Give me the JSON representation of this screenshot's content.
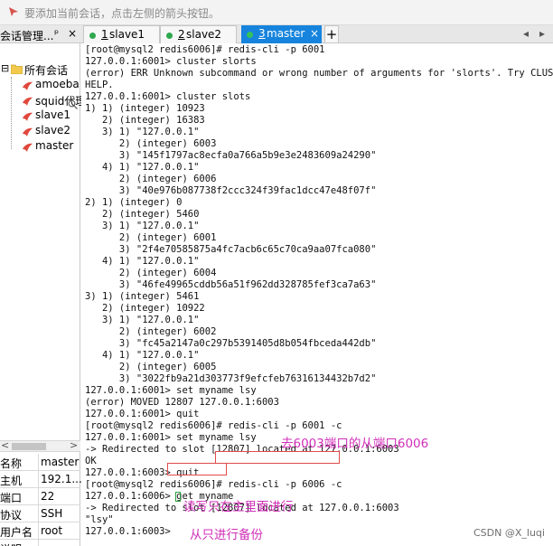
{
  "hint_bar": {
    "text": "要添加当前会话，点击左侧的箭头按钮。"
  },
  "session_panel": {
    "title": "会话管理...",
    "pin": "ᵖ",
    "close": "×",
    "root_label": "所有会话",
    "sessions": [
      "amoeba",
      "squid代理",
      "slave1",
      "slave2",
      "master"
    ]
  },
  "properties": [
    {
      "key": "名称",
      "value": "master"
    },
    {
      "key": "主机",
      "value": "192.1..."
    },
    {
      "key": "端口",
      "value": "22"
    },
    {
      "key": "协议",
      "value": "SSH"
    },
    {
      "key": "用户名",
      "value": "root"
    },
    {
      "key": "说明",
      "value": ""
    }
  ],
  "tabs": [
    {
      "num": "1",
      "label": "slave1",
      "active": false
    },
    {
      "num": "2",
      "label": "slave2",
      "active": false
    },
    {
      "num": "3",
      "label": "master",
      "active": true
    }
  ],
  "tab_add": "+",
  "terminal_lines": [
    "[root@mysql2 redis6006]# redis-cli -p 6001",
    "127.0.0.1:6001> cluster slorts",
    "(error) ERR Unknown subcommand or wrong number of arguments for 'slorts'. Try CLUSTER",
    "HELP.",
    "127.0.0.1:6001> cluster slots",
    "1) 1) (integer) 10923",
    "   2) (integer) 16383",
    "   3) 1) \"127.0.0.1\"",
    "      2) (integer) 6003",
    "      3) \"145f1797ac8ecfa0a766a5b9e3e2483609a24290\"",
    "   4) 1) \"127.0.0.1\"",
    "      2) (integer) 6006",
    "      3) \"40e976b087738f2ccc324f39fac1dcc47e48f07f\"",
    "2) 1) (integer) 0",
    "   2) (integer) 5460",
    "   3) 1) \"127.0.0.1\"",
    "      2) (integer) 6001",
    "      3) \"2f4e70585875a4fc7acb6c65c70ca9aa07fca080\"",
    "   4) 1) \"127.0.0.1\"",
    "      2) (integer) 6004",
    "      3) \"46fe49965cddb56a51f962dd328785fef3ca7a63\"",
    "3) 1) (integer) 5461",
    "   2) (integer) 10922",
    "   3) 1) \"127.0.0.1\"",
    "      2) (integer) 6002",
    "      3) \"fc45a2147a0c297b5391405d8b054fbceda442db\"",
    "   4) 1) \"127.0.0.1\"",
    "      2) (integer) 6005",
    "      3) \"3022fb9a21d303773f9efcfeb76316134432b7d2\"",
    "127.0.0.1:6001> set myname lsy",
    "(error) MOVED 12807 127.0.0.1:6003",
    "127.0.0.1:6001> quit",
    "[root@mysql2 redis6006]# redis-cli -p 6001 -c",
    "127.0.0.1:6001> set myname lsy",
    "-> Redirected to slot [12807] located at 127.0.0.1:6003",
    "OK",
    "127.0.0.1:6003> quit",
    "[root@mysql2 redis6006]# redis-cli -p 6006 -c",
    "127.0.0.1:6006> get myname",
    "-> Redirected to slot [12807] located at 127.0.0.1:6003",
    "\"lsy\"",
    "127.0.0.1:6003> "
  ],
  "annotations": {
    "a1": "去6003端口的从端口6006",
    "a2": "读写只在主里面进行",
    "a3": "从只进行备份"
  },
  "watermark": "CSDN @X_luqi",
  "colors": {
    "active_tab": "#1684dd",
    "connected_dot": "#2fa84f",
    "annotation": "#d12fb8",
    "highlight_box": "#e24a4a",
    "session_icon": "#e0483b"
  }
}
